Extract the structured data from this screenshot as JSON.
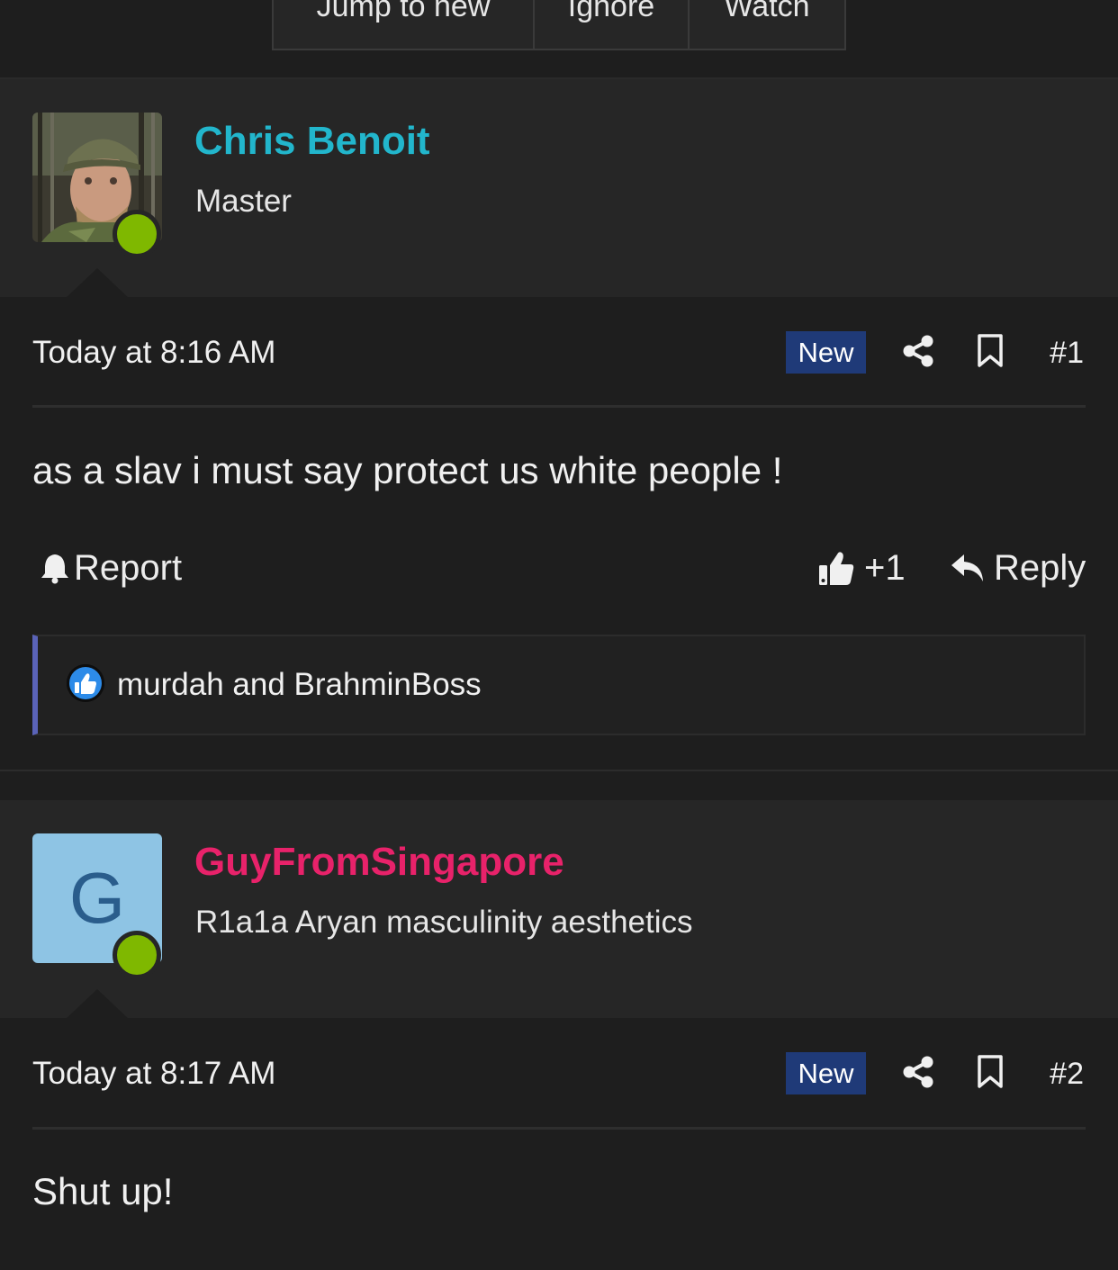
{
  "toolbar": {
    "jump_label": "Jump to new",
    "ignore_label": "Ignore",
    "watch_label": "Watch"
  },
  "posts": [
    {
      "username": "Chris Benoit",
      "user_title": "Master",
      "username_color": "#22b6cc",
      "timestamp": "Today at 8:16 AM",
      "badge": "New",
      "number": "#1",
      "message": "as a slav i must say protect us white people !",
      "report_label": "Report",
      "like_count": "+1",
      "reply_label": "Reply",
      "reactions_text": "murdah and BrahminBoss"
    },
    {
      "username": "GuyFromSingapore",
      "user_title": "R1a1a Aryan masculinity aesthetics",
      "username_color": "#e8226a",
      "avatar_letter": "G",
      "timestamp": "Today at 8:17 AM",
      "badge": "New",
      "number": "#2",
      "message": "Shut up!"
    }
  ],
  "icons": {
    "online": "online-status-dot",
    "share": "share-icon",
    "bookmark": "bookmark-icon",
    "report": "bell-icon",
    "like": "thumbs-up-icon",
    "reply": "reply-arrow-icon"
  }
}
